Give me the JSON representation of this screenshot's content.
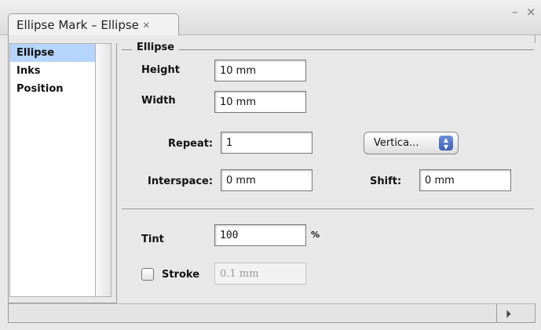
{
  "tab": {
    "title": "Ellipse Mark – Ellipse",
    "close_glyph": "×"
  },
  "window": {
    "minimize_glyph": "–",
    "close_glyph": "×"
  },
  "sidebar": {
    "items": [
      {
        "label": "Ellipse",
        "selected": true
      },
      {
        "label": "Inks"
      },
      {
        "label": "Position"
      }
    ]
  },
  "group": {
    "legend": "Ellipse"
  },
  "fields": {
    "height": {
      "label": "Height",
      "value": "10 mm"
    },
    "width": {
      "label": "Width",
      "value": "10 mm"
    },
    "repeat": {
      "label": "Repeat:",
      "value": "1"
    },
    "interspace": {
      "label": "Interspace:",
      "value": "0 mm"
    },
    "shift": {
      "label": "Shift:",
      "value": "0 mm"
    },
    "tint": {
      "label": "Tint",
      "value": "100",
      "unit": "%"
    },
    "stroke": {
      "label": "Stroke",
      "value": "0.1 mm",
      "checked": false
    }
  },
  "direction_popup": {
    "selected": "Vertica...",
    "arrows": "▲\n▼"
  },
  "statusbar": {
    "play_glyph": "⏵"
  },
  "colors": {
    "selection": "#b5d5fd",
    "popup_arrows": "#3a5fb5"
  }
}
